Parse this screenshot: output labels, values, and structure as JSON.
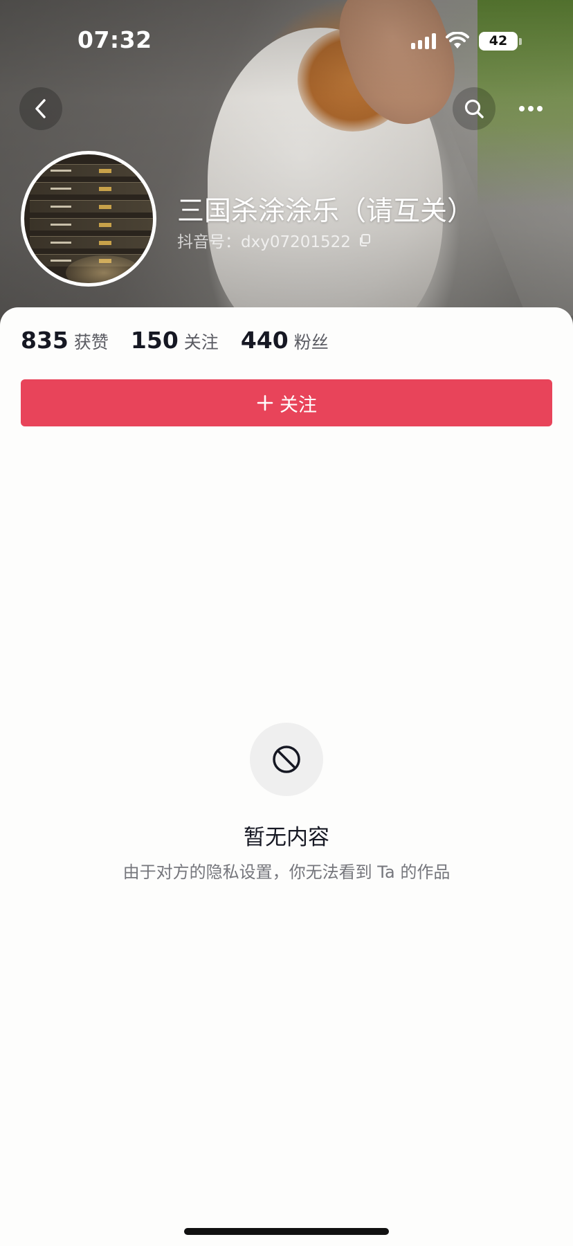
{
  "status_bar": {
    "time": "07:32",
    "battery": "42"
  },
  "header": {
    "back_icon": "chevron-left-icon",
    "search_icon": "search-icon",
    "more_icon": "more-horizontal-icon"
  },
  "profile": {
    "name": "三国杀涂涂乐（请互关）",
    "id_label": "抖音号：",
    "id_value": "dxy07201522",
    "copy_icon": "copy-icon"
  },
  "stats": [
    {
      "value": "835",
      "label": "获赞"
    },
    {
      "value": "150",
      "label": "关注"
    },
    {
      "value": "440",
      "label": "粉丝"
    }
  ],
  "follow_button": {
    "icon": "plus-icon",
    "label": "关注",
    "color": "#e8445a"
  },
  "empty_state": {
    "icon": "block-icon",
    "title": "暂无内容",
    "description": "由于对方的隐私设置，你无法看到 Ta 的作品"
  }
}
